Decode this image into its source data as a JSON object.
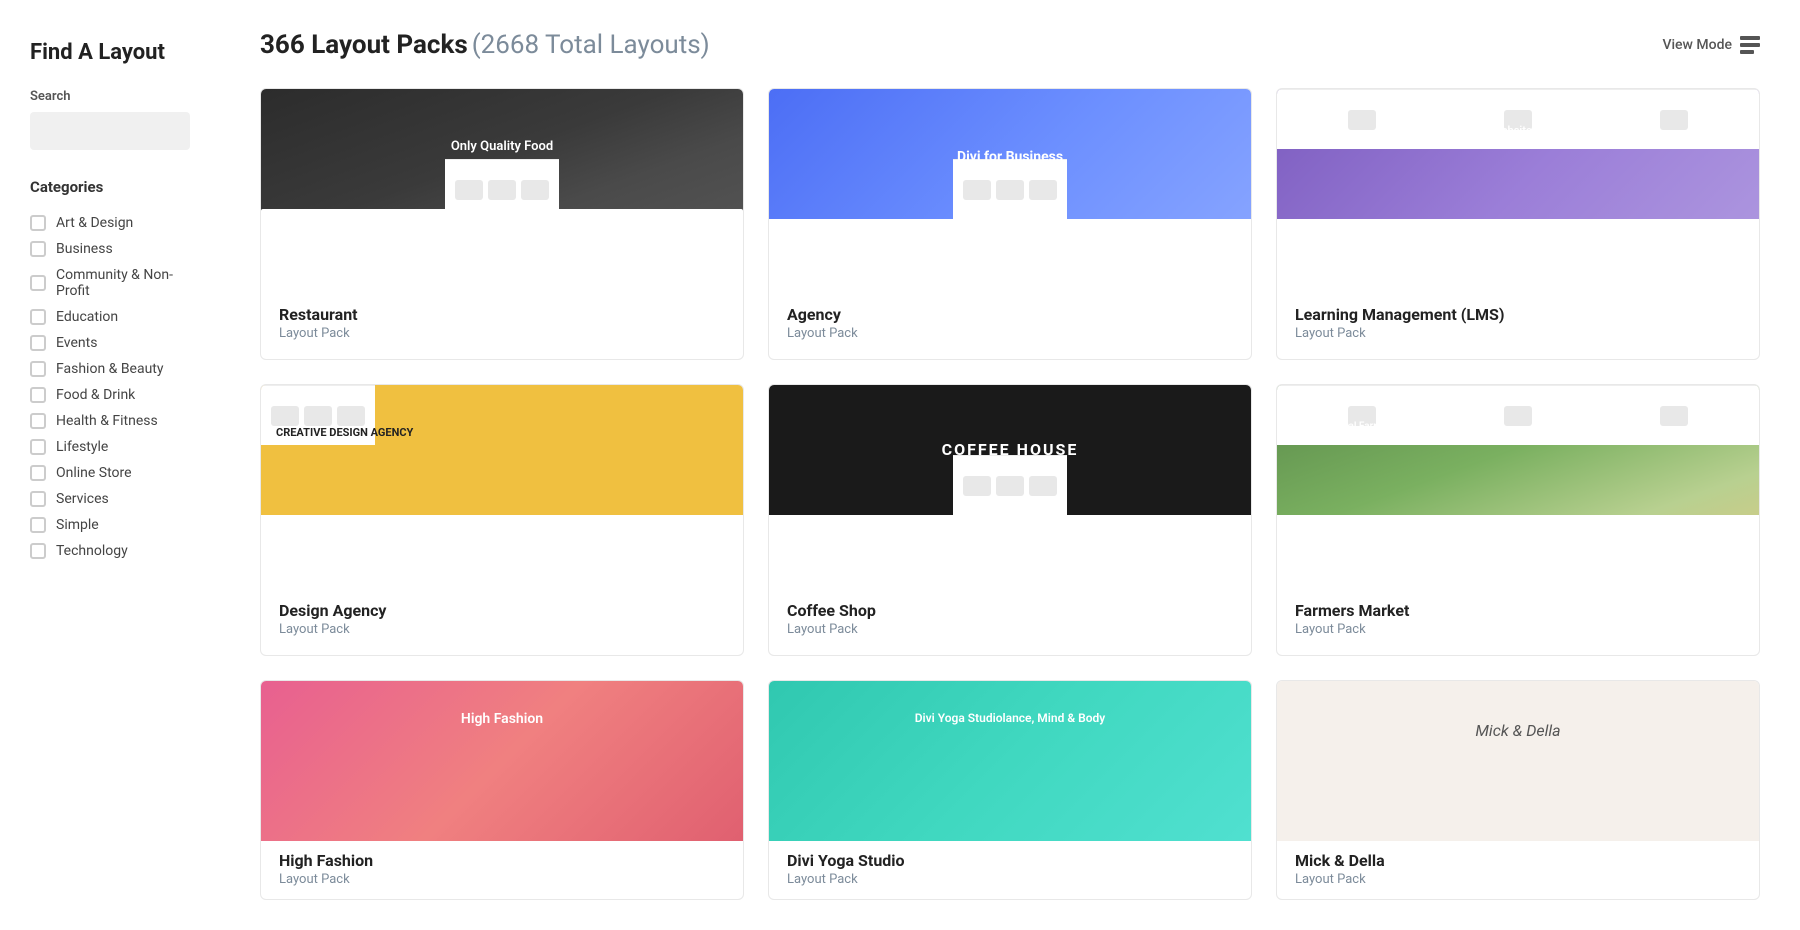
{
  "sidebar": {
    "title": "Find A Layout",
    "search": {
      "label": "Search",
      "placeholder": ""
    },
    "categories_label": "Categories",
    "categories": [
      {
        "id": "art-design",
        "label": "Art & Design",
        "checked": false
      },
      {
        "id": "business",
        "label": "Business",
        "checked": false
      },
      {
        "id": "community",
        "label": "Community & Non-Profit",
        "checked": false
      },
      {
        "id": "education",
        "label": "Education",
        "checked": false
      },
      {
        "id": "events",
        "label": "Events",
        "checked": false
      },
      {
        "id": "fashion",
        "label": "Fashion & Beauty",
        "checked": false
      },
      {
        "id": "food",
        "label": "Food & Drink",
        "checked": false
      },
      {
        "id": "health",
        "label": "Health & Fitness",
        "checked": false
      },
      {
        "id": "lifestyle",
        "label": "Lifestyle",
        "checked": false
      },
      {
        "id": "online-store",
        "label": "Online Store",
        "checked": false
      },
      {
        "id": "services",
        "label": "Services",
        "checked": false
      },
      {
        "id": "simple",
        "label": "Simple",
        "checked": false
      },
      {
        "id": "technology",
        "label": "Technology",
        "checked": false
      }
    ]
  },
  "header": {
    "pack_count": "366 Layout Packs",
    "layout_count": "(2668 Total Layouts)",
    "view_mode_label": "View Mode"
  },
  "cards": [
    {
      "id": "restaurant",
      "title": "Restaurant",
      "subtitle": "Layout Pack",
      "image_type": "restaurant"
    },
    {
      "id": "agency",
      "title": "Agency",
      "subtitle": "Layout Pack",
      "image_type": "agency"
    },
    {
      "id": "lms",
      "title": "Learning Management (LMS)",
      "subtitle": "Layout Pack",
      "image_type": "lms"
    },
    {
      "id": "design-agency",
      "title": "Design Agency",
      "subtitle": "Layout Pack",
      "image_type": "design-agency"
    },
    {
      "id": "coffee-shop",
      "title": "Coffee Shop",
      "subtitle": "Layout Pack",
      "image_type": "coffee"
    },
    {
      "id": "farmers-market",
      "title": "Farmers Market",
      "subtitle": "Layout Pack",
      "image_type": "farmers"
    },
    {
      "id": "fashion-partial",
      "title": "High Fashion",
      "subtitle": "Layout Pack",
      "image_type": "fashion"
    },
    {
      "id": "yoga-partial",
      "title": "Divi Yoga Studio",
      "subtitle": "Layout Pack",
      "image_type": "yoga"
    },
    {
      "id": "mick-partial",
      "title": "Mick & Della",
      "subtitle": "Layout Pack",
      "image_type": "mick"
    }
  ]
}
